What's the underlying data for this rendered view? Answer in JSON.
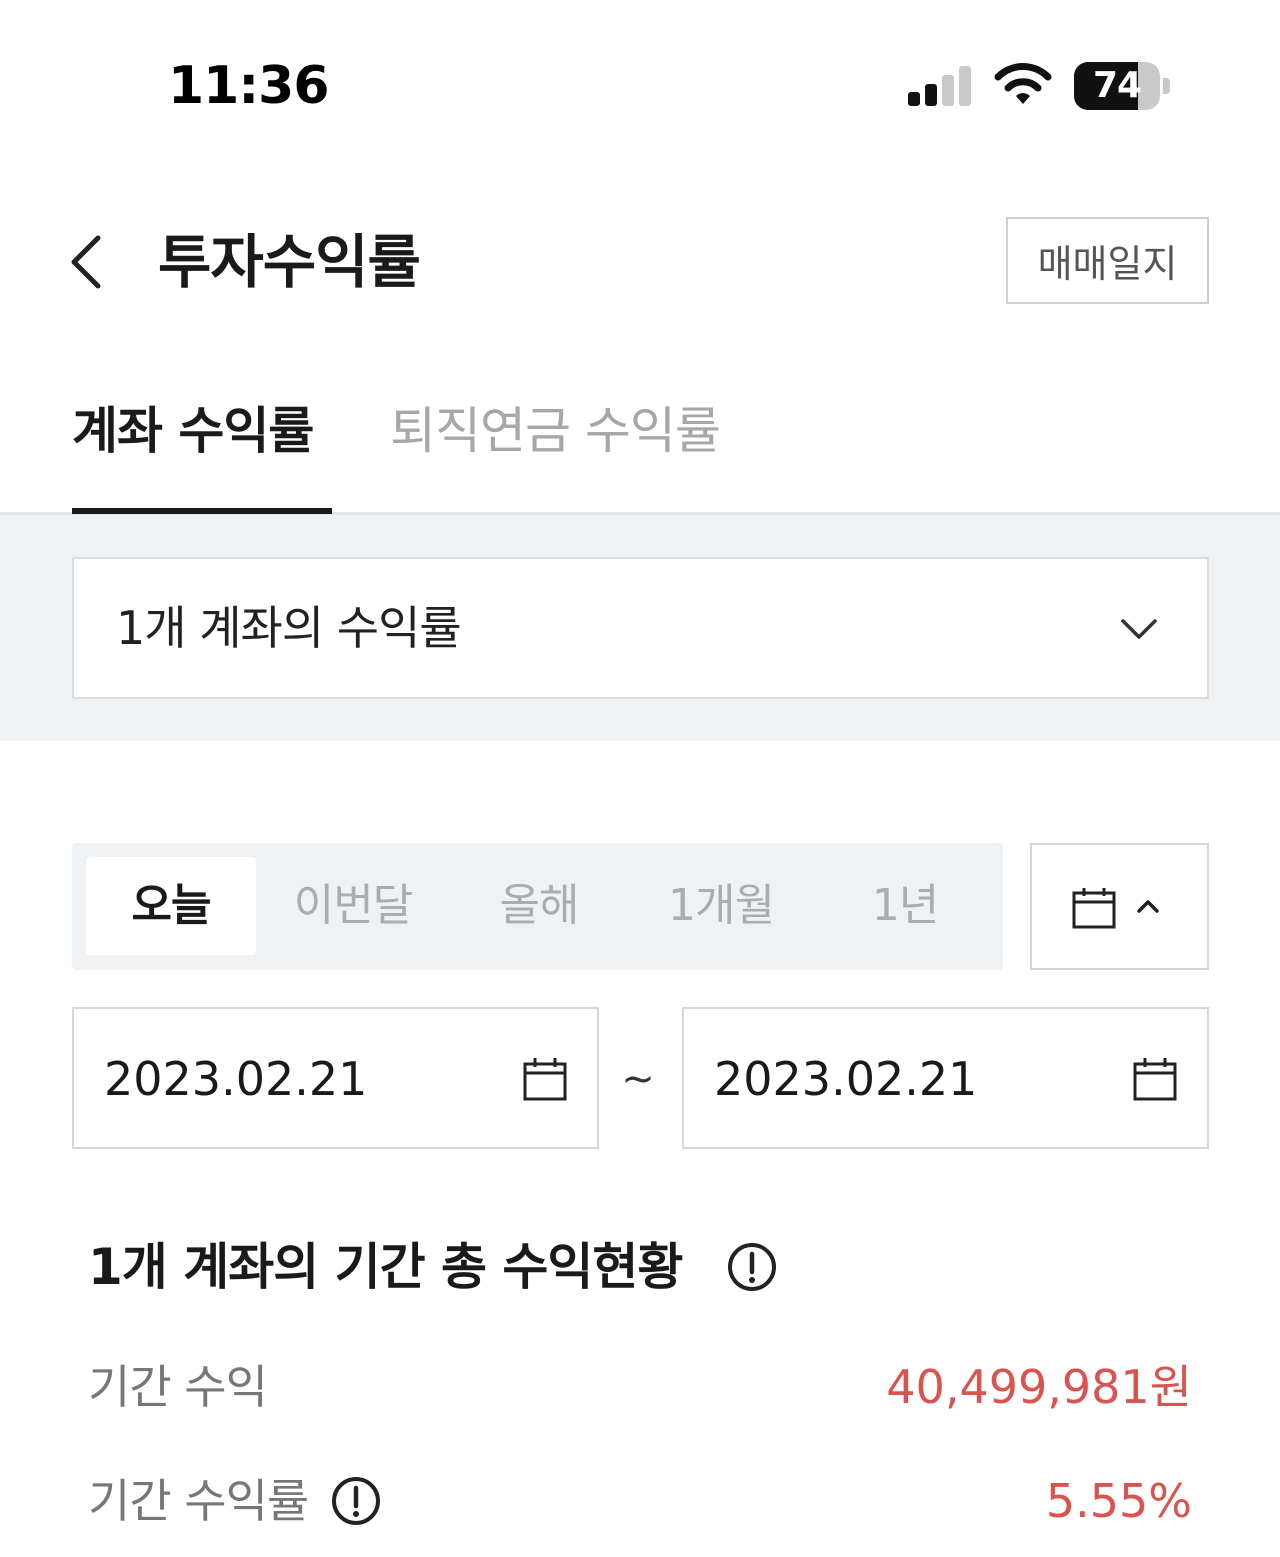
{
  "status_bar": {
    "time": "11:36",
    "battery_percent": "74",
    "battery_level": 0.74,
    "signal_bars_active": 2,
    "signal_bars_total": 4
  },
  "header": {
    "title": "투자수익률",
    "journal_button": "매매일지"
  },
  "tabs": [
    {
      "label": "계좌 수익률",
      "active": true
    },
    {
      "label": "퇴직연금 수익률",
      "active": false
    }
  ],
  "account_selector": {
    "label": "1개 계좌의 수익률"
  },
  "period": {
    "options": [
      "오늘",
      "이번달",
      "올해",
      "1개월",
      "1년"
    ],
    "selected": "오늘"
  },
  "date_range": {
    "start": "2023.02.21",
    "separator": "~",
    "end": "2023.02.21"
  },
  "summary": {
    "title": "1개 계좌의 기간 총 수익현황",
    "rows": [
      {
        "label": "기간 수익",
        "value": "40,499,981원"
      },
      {
        "label": "기간 수익률",
        "value": "5.55%"
      }
    ]
  },
  "colors": {
    "accent_text": "#1a1a1a",
    "inactive_tab": "#a7a7a7",
    "profit": "#d9534f",
    "band_background": "#eef2f5"
  }
}
